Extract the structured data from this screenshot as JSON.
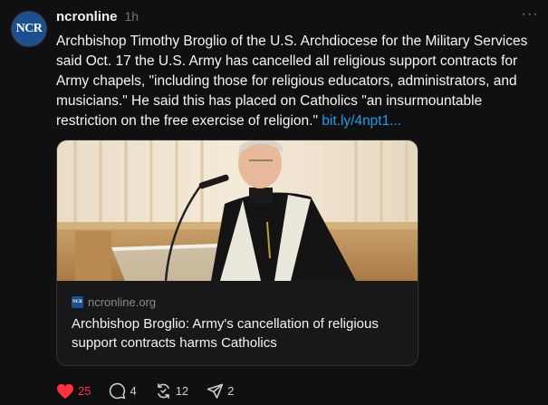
{
  "post": {
    "avatar_text": "NCR",
    "username": "ncronline",
    "time": "1h",
    "more_label": "···",
    "text": "Archbishop Timothy Broglio of the U.S. Archdiocese for the Military Services said Oct. 17 the U.S. Army has cancelled all religious support contracts for Army chapels, \"including those for religious educators, administrators, and musicians.\" He said this has placed on Catholics \"an insurmountable restriction on the free exercise of religion.\"",
    "link_text": "bit.ly/4npt1..."
  },
  "link_card": {
    "image_description_icon": "photo-archbishop-at-podium",
    "favicon_text": "NCR",
    "domain": "ncronline.org",
    "title": "Archbishop Broglio: Army's cancellation of religious support contracts harms Catholics"
  },
  "actions": {
    "likes": "25",
    "replies": "4",
    "reposts": "12",
    "shares": "2",
    "like_icon": "heart-icon",
    "reply_icon": "comment-icon",
    "repost_icon": "repost-icon",
    "share_icon": "send-icon"
  },
  "colors": {
    "background": "#101010",
    "text": "#f3f5f7",
    "muted": "#777777",
    "link": "#1d9bf0",
    "like": "#ff3040"
  }
}
